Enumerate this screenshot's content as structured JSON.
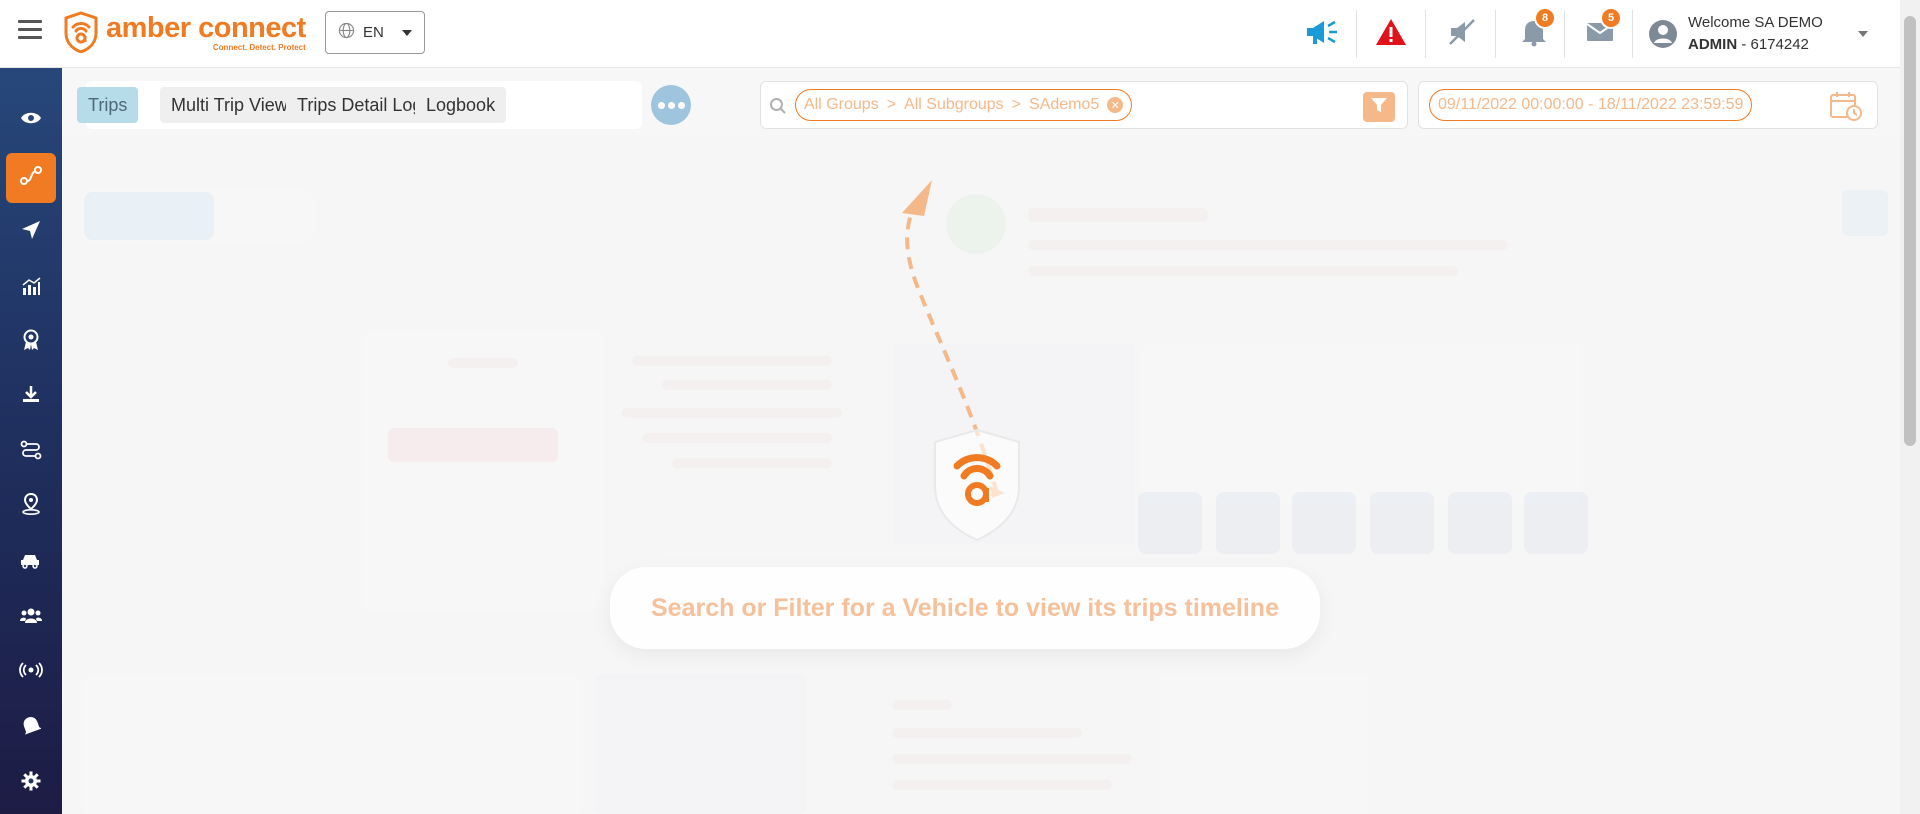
{
  "header": {
    "brand_name": "amber connect",
    "brand_tagline": "Connect. Detect. Protect",
    "language": "EN",
    "notifications": [
      {
        "icon": "megaphone-icon",
        "count": ""
      },
      {
        "icon": "alert-triangle-icon",
        "count": ""
      },
      {
        "icon": "muted-speaker-icon",
        "count": ""
      },
      {
        "icon": "bell-icon",
        "count": "8"
      },
      {
        "icon": "mail-icon",
        "count": "5"
      }
    ],
    "user": {
      "welcome": "Welcome SA DEMO",
      "role": "ADMIN",
      "id_suffix": " - 6174242"
    }
  },
  "sidebar": {
    "items": [
      {
        "name": "eye-icon",
        "active": false
      },
      {
        "name": "route-icon",
        "active": true
      },
      {
        "name": "navigation-icon",
        "active": false
      },
      {
        "name": "analytics-icon",
        "active": false
      },
      {
        "name": "award-icon",
        "active": false
      },
      {
        "name": "download-icon",
        "active": false
      },
      {
        "name": "trip-path-icon",
        "active": false
      },
      {
        "name": "location-pin-icon",
        "active": false
      },
      {
        "name": "vehicles-icon",
        "active": false
      },
      {
        "name": "users-icon",
        "active": false
      },
      {
        "name": "broadcast-icon",
        "active": false
      },
      {
        "name": "alerts-bell-icon",
        "active": false
      },
      {
        "name": "settings-icon",
        "active": false
      }
    ]
  },
  "tabs": [
    {
      "label": "Trips",
      "active": true
    },
    {
      "label": "Multi Trip View",
      "active": false
    },
    {
      "label": "Trips Detail Log",
      "active": false
    },
    {
      "label": "Logbook",
      "active": false
    }
  ],
  "filter": {
    "groups": "All Groups",
    "separator": ">",
    "subgroups": "All Subgroups",
    "vehicle": "SAdemo5"
  },
  "date_range": "09/11/2022 00:00:00 - 18/11/2022 23:59:59",
  "empty_state": {
    "message": "Search or Filter for a Vehicle to view its trips timeline"
  },
  "colors": {
    "brand_orange": "#f07b22",
    "sidebar_top": "#27477a",
    "sidebar_bottom": "#1d1c45",
    "active_tab": "#b6dbe9"
  }
}
